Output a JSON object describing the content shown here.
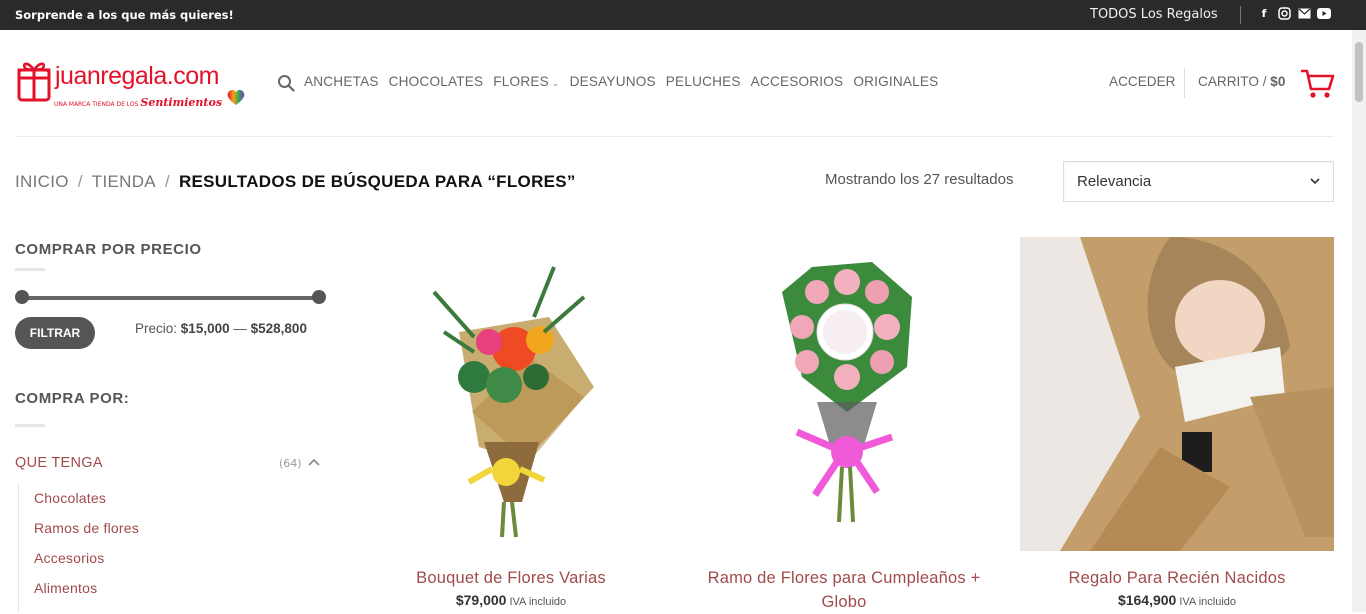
{
  "topbar": {
    "promo": "Sorprende a los que más quieres!",
    "all_gifts": "TODOS Los Regalos",
    "social": [
      "facebook-icon",
      "instagram-icon",
      "mail-icon",
      "youtube-icon"
    ]
  },
  "logo": {
    "brand": "juanregala.com",
    "tagline_small": "UNA MARCA TIENDA DE LOS",
    "tagline_script": "Sentimientos"
  },
  "nav": {
    "items": [
      {
        "label": "ANCHETAS"
      },
      {
        "label": "CHOCOLATES"
      },
      {
        "label": "FLORES",
        "has_dropdown": true
      },
      {
        "label": "DESAYUNOS"
      },
      {
        "label": "PELUCHES"
      },
      {
        "label": "ACCESORIOS"
      },
      {
        "label": "ORIGINALES"
      }
    ],
    "login": "ACCEDER",
    "cart_label": "CARRITO",
    "cart_sep": "/",
    "cart_total": "$0"
  },
  "breadcrumb": {
    "home": "INICIO",
    "sep": "/",
    "shop": "TIENDA",
    "current": "RESULTADOS DE BÚSQUEDA PARA “FLORES”"
  },
  "results": {
    "showing": "Mostrando los 27 resultados",
    "sort_selected": "Relevancia"
  },
  "sidebar": {
    "price_heading": "COMPRAR POR PRECIO",
    "filter_button": "FILTRAR",
    "price_label": "Precio:",
    "price_min": "$15,000",
    "price_dash": "—",
    "price_max": "$528,800",
    "buy_by_heading": "COMPRA POR:",
    "category": {
      "label": "QUE TENGA",
      "count": "(64)"
    },
    "subcategories": [
      "Chocolates",
      "Ramos de flores",
      "Accesorios",
      "Alimentos"
    ]
  },
  "products": [
    {
      "title": "Bouquet de Flores Varias",
      "price": "$79,000",
      "tax": "IVA incluido"
    },
    {
      "title": "Ramo de Flores para Cumpleaños + Globo",
      "price": "",
      "tax": ""
    },
    {
      "title": "Regalo Para Recién Nacidos",
      "price": "$164,900",
      "tax": "IVA incluido"
    }
  ],
  "colors": {
    "brand_red": "#e3122a",
    "link": "#a14b4b",
    "topbar": "#2a2a2a"
  }
}
